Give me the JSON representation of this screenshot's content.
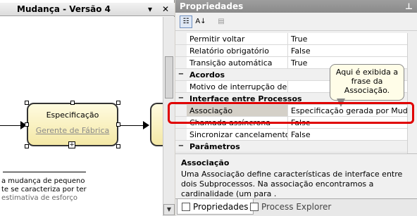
{
  "left_pane": {
    "title": "Mudança - Versão 4",
    "dropdown_glyph": "▾",
    "close_glyph": "✕",
    "shape": {
      "name": "Especificação",
      "owner": "Gerente de Fábrica",
      "expand_glyph": "+"
    },
    "description_lines": [
      "a mudança de pequeno",
      "te se caracteriza por ter",
      "estimativa de esforço"
    ]
  },
  "properties": {
    "title": "Propriedades",
    "pin_glyph": "⊥",
    "toolbar": {
      "categorized_icon": "categorized-icon",
      "alpha_icon": "alphabetical-icon",
      "pages_icon": "property-pages-icon"
    },
    "rows": [
      {
        "type": "prop",
        "name": "Permitir voltar",
        "value": "True"
      },
      {
        "type": "prop",
        "name": "Relatório obrigatório",
        "value": "False"
      },
      {
        "type": "prop",
        "name": "Transição automática",
        "value": "True"
      },
      {
        "type": "cat",
        "name": "Acordos",
        "toggle": "−"
      },
      {
        "type": "prop",
        "name": "Motivo de interrupção de ANS",
        "value": ""
      },
      {
        "type": "cat",
        "name": "Interface entre Processos",
        "toggle": "−"
      },
      {
        "type": "prop",
        "name": "Associação",
        "value": "Especificação gerada por Mudança"
      },
      {
        "type": "prop",
        "name": "Chamada assíncrona",
        "value": "False"
      },
      {
        "type": "prop",
        "name": "Sincronizar cancelamento",
        "value": "False"
      },
      {
        "type": "cat",
        "name": "Parâmetros",
        "toggle": "−"
      }
    ],
    "help": {
      "title": "Associação",
      "text": "Uma Associação define características de interface entre dois Subprocessos. Na associação encontramos a cardinalidade (um para ."
    },
    "tabs": [
      {
        "label": "Propriedades",
        "active": true
      },
      {
        "label": "Process Explorer",
        "active": false
      }
    ]
  },
  "callout": {
    "text": "Aqui é exibida a frase da Associação."
  },
  "colors": {
    "highlight": "#e00000",
    "shape_fill": "#f4e8a6"
  }
}
